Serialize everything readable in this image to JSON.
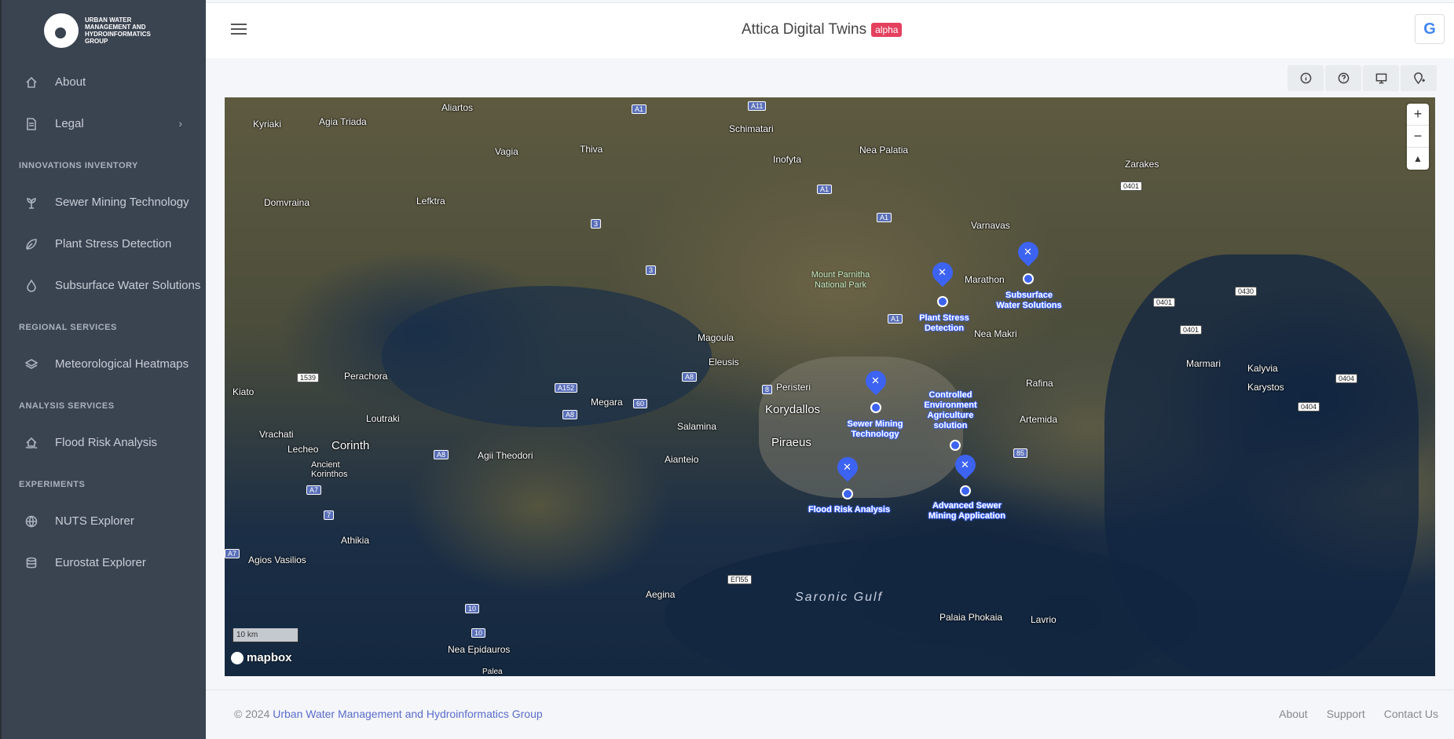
{
  "logo": {
    "text": "URBAN WATER MANAGEMENT AND HYDROINFORMATICS GROUP"
  },
  "sidebar": {
    "about": "About",
    "legal": "Legal",
    "sections": {
      "innovations": "INNOVATIONS INVENTORY",
      "regional": "REGIONAL SERVICES",
      "analysis": "ANALYSIS SERVICES",
      "experiments": "EXPERIMENTS"
    },
    "items": {
      "sewer": "Sewer Mining Technology",
      "plant": "Plant Stress Detection",
      "subsurface": "Subsurface Water Solutions",
      "meteo": "Meteorological Heatmaps",
      "flood": "Flood Risk Analysis",
      "nuts": "NUTS Explorer",
      "eurostat": "Eurostat Explorer"
    }
  },
  "header": {
    "title": "Attica Digital Twins",
    "badge": "alpha",
    "google": "G"
  },
  "map": {
    "places": {
      "aliartos": "Aliartos",
      "kyriaki": "Kyriaki",
      "agiatriada": "Agia Triada",
      "vagia": "Vagia",
      "thiva": "Thiva",
      "schimatari": "Schimatari",
      "inofyta": "Inofyta",
      "neapalatia": "Nea Palatia",
      "zarakes": "Zarakes",
      "domvraina": "Domvraina",
      "lefktra": "Lefktra",
      "varnavas": "Varnavas",
      "marathon": "Marathon",
      "neamakri": "Nea Makri",
      "magoula": "Magoula",
      "eleusis": "Eleusis",
      "perachora": "Perachora",
      "kiato": "Kiato",
      "loutraki": "Loutraki",
      "vrachati": "Vrachati",
      "corinth": "Corinth",
      "lecheo": "Lecheo",
      "ancient": "Ancient Korinthos",
      "agiitheodori": "Agii Theodori",
      "megara": "Megara",
      "salamina": "Salamina",
      "peristeri": "Peristeri",
      "korydallos": "Korydallos",
      "piraeus": "Piraeus",
      "rafina": "Rafina",
      "artemida": "Artemida",
      "aiantelo": "Aianteio",
      "marmari": "Marmari",
      "kalyvia": "Kalyvia",
      "karystos": "Karystos",
      "athikia": "Athikia",
      "agiosvasilios": "Agios Vasilios",
      "aegina": "Aegina",
      "neaepidauros": "Nea Epidauros",
      "palaiaphokaia": "Palaia Phokaia",
      "lavrio": "Lavrio",
      "palea": "Palea",
      "gulf": "Saronic Gulf",
      "park": "Mount Parnitha National Park"
    },
    "shields": {
      "a1a": "A1",
      "a11": "A11",
      "a1b": "A1",
      "a1c": "A1",
      "a1d": "A1",
      "s3a": "3",
      "s3b": "3",
      "r0401a": "0401",
      "r0401b": "0401",
      "r0401c": "0401",
      "r0430": "0430",
      "r0404a": "0404",
      "r0404b": "0404",
      "r1539": "1539",
      "a152": "A152",
      "a8a": "A8",
      "a8b": "A8",
      "a8c": "A8",
      "s60": "60",
      "s8": "8",
      "s85": "85",
      "a7a": "A7",
      "a7b": "A7",
      "s7": "7",
      "s10a": "10",
      "s10b": "10",
      "e55": "ΕΠ55"
    },
    "markers": {
      "subsurface": "Subsurface Water Solutions",
      "plant": "Plant Stress Detection",
      "sewer": "Sewer Mining Technology",
      "controlled": "Controlled Environment Agriculture solution",
      "advanced": "Advanced Sewer Mining Application",
      "flood": "Flood Risk Analysis"
    },
    "zoom_in": "+",
    "zoom_out": "−",
    "compass": "▲",
    "scale": "10 km",
    "attribution": "mapbox"
  },
  "footer": {
    "copyright": "© 2024 ",
    "org": "Urban Water Management and Hydroinformatics Group",
    "links": {
      "about": "About",
      "support": "Support",
      "contact": "Contact Us"
    }
  }
}
